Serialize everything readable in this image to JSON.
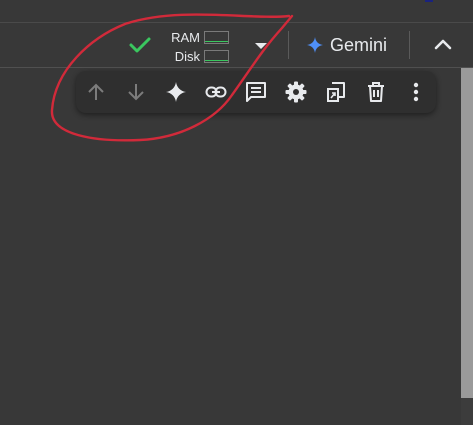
{
  "header": {
    "status_icon": "check-icon",
    "resources": {
      "ram_label": "RAM",
      "disk_label": "Disk",
      "ram_usage": 0.05,
      "disk_usage": 0.05,
      "fill_color": "#3ac75f"
    },
    "gemini_label": "Gemini",
    "gemini_icon": "gemini-star-icon",
    "collapse_icon": "chevron-up-icon"
  },
  "cell_toolbar": {
    "items": [
      {
        "icon": "arrow-up-icon",
        "enabled": false
      },
      {
        "icon": "arrow-down-icon",
        "enabled": false
      },
      {
        "icon": "sparkle-icon",
        "enabled": true
      },
      {
        "icon": "link-icon",
        "enabled": true
      },
      {
        "icon": "comment-icon",
        "enabled": true
      },
      {
        "icon": "gear-icon",
        "enabled": true
      },
      {
        "icon": "mirror-cell-icon",
        "enabled": true
      },
      {
        "icon": "trash-icon",
        "enabled": true
      },
      {
        "icon": "more-vert-icon",
        "enabled": true
      }
    ]
  },
  "colors": {
    "background": "#383838",
    "check": "#3ac75f",
    "annotation": "#d12a3a",
    "gemini_star": "#4f8ff7"
  }
}
